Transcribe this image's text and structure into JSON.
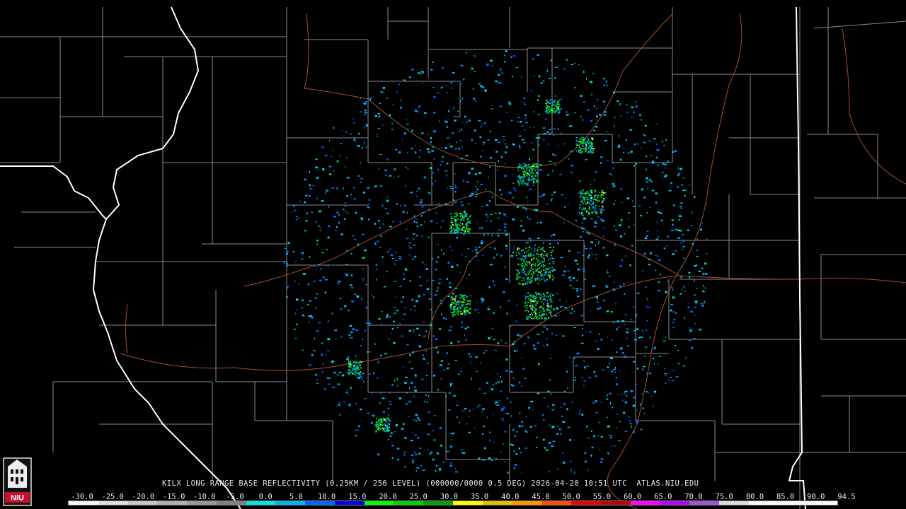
{
  "caption": "KILX LONG RANGE BASE REFLECTIVITY (0.25KM / 256 LEVEL) (000000/0000 0.5 DEG) 2026-04-20 10:51 UTC  ATLAS.NIU.EDU",
  "logo_text": "NIU",
  "colors": {
    "background": "#000000",
    "county_lines": "#8a8a8a",
    "state_lines": "#ffffff",
    "rivers": "#a0522d"
  },
  "scale": {
    "labels": [
      "-30.0",
      "-25.0",
      "-20.0",
      "-15.0",
      "-10.0",
      "-5.0",
      "0.0",
      "5.0",
      "10.0",
      "15.0",
      "20.0",
      "25.0",
      "30.0",
      "35.0",
      "40.0",
      "45.0",
      "50.0",
      "55.0",
      "60.0",
      "65.0",
      "70.0",
      "75.0",
      "80.0",
      "85.0",
      "90.0",
      "94.5"
    ],
    "colors": [
      "#ffffff",
      "#e0e0e0",
      "#c8c8c8",
      "#b0b0b0",
      "#989898",
      "#808080",
      "#00e6e6",
      "#00b4f0",
      "#0064ff",
      "#0000e6",
      "#00ff00",
      "#00d200",
      "#00a000",
      "#ffff00",
      "#e6c000",
      "#ff9600",
      "#ff4b00",
      "#e60000",
      "#b40000",
      "#ff00ff",
      "#b400ff",
      "#9a58d6",
      "#dcdcdc",
      "#ffffff",
      "#ffffff",
      "#ffffff"
    ]
  }
}
